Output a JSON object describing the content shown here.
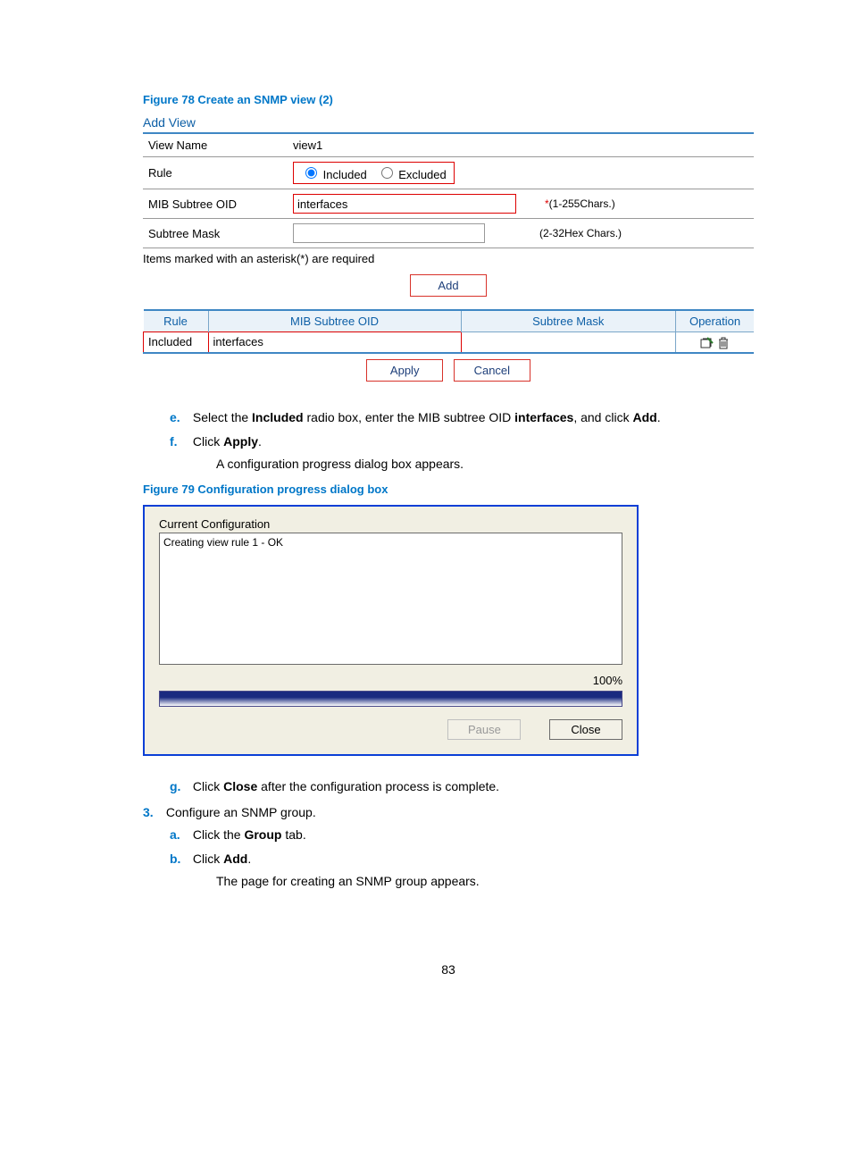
{
  "figure78": {
    "caption": "Figure 78 Create an SNMP view (2)",
    "heading": "Add View",
    "rows": {
      "view_name_label": "View Name",
      "view_name_value": "view1",
      "rule_label": "Rule",
      "rule_opt_included": "Included",
      "rule_opt_excluded": "Excluded",
      "mib_label": "MIB Subtree OID",
      "mib_value": "interfaces",
      "mib_hint": "(1-255Chars.)",
      "mask_label": "Subtree Mask",
      "mask_value": "",
      "mask_hint": "(2-32Hex Chars.)"
    },
    "req_note": "Items marked with an asterisk(*) are required",
    "add_btn": "Add",
    "table": {
      "headers": {
        "rule": "Rule",
        "mib": "MIB Subtree OID",
        "mask": "Subtree Mask",
        "op": "Operation"
      },
      "row1": {
        "rule": "Included",
        "mib": "interfaces",
        "mask": ""
      }
    },
    "apply_btn": "Apply",
    "cancel_btn": "Cancel"
  },
  "instr1": {
    "e_marker": "e.",
    "e_text_1": "Select the ",
    "e_bold_1": "Included",
    "e_text_2": " radio box, enter the MIB subtree OID ",
    "e_bold_2": "interfaces",
    "e_text_3": ", and click ",
    "e_bold_3": "Add",
    "e_text_4": ".",
    "f_marker": "f.",
    "f_text_1": "Click ",
    "f_bold_1": "Apply",
    "f_text_2": ".",
    "f_sub": "A configuration progress dialog box appears."
  },
  "figure79": {
    "caption": "Figure 79 Configuration progress dialog box",
    "title": "Current Configuration",
    "log_line": "Creating view rule 1 - OK",
    "percent": "100%",
    "pause_btn": "Pause",
    "close_btn": "Close"
  },
  "instr2": {
    "g_marker": "g.",
    "g_text_1": "Click ",
    "g_bold_1": "Close",
    "g_text_2": " after the configuration process is complete.",
    "step3_marker": "3.",
    "step3_text": "Configure an SNMP group.",
    "a_marker": "a.",
    "a_text_1": "Click the ",
    "a_bold_1": "Group",
    "a_text_2": " tab.",
    "b_marker": "b.",
    "b_text_1": "Click ",
    "b_bold_1": "Add",
    "b_text_2": ".",
    "b_sub": "The page for creating an SNMP group appears."
  },
  "page_number": "83"
}
